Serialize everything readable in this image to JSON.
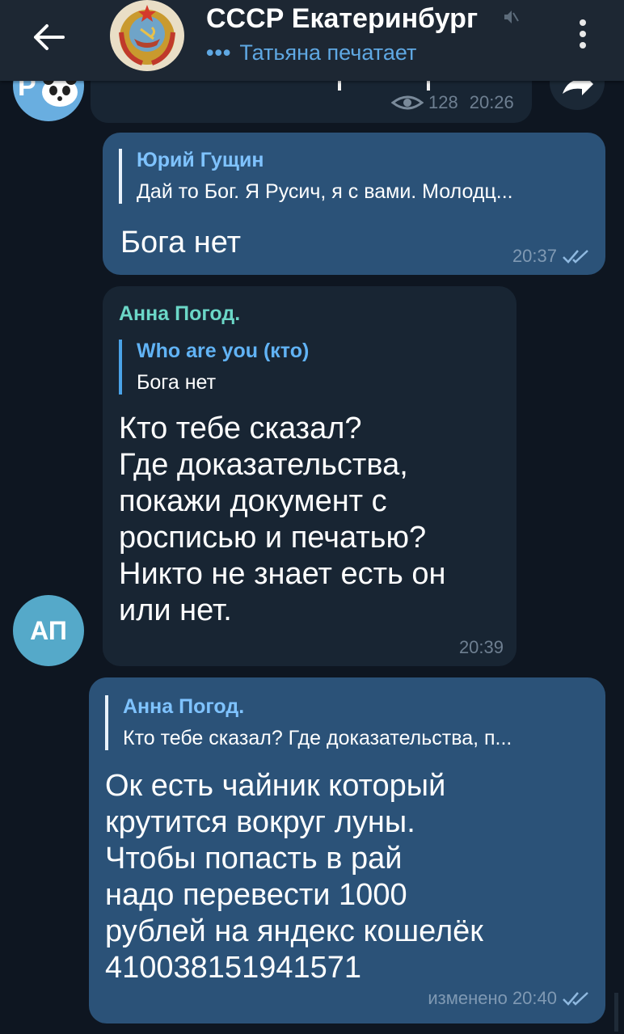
{
  "header": {
    "title": "СССР Екатеринбург",
    "typing_dots": "•••",
    "subtitle": "Татьяна печатает",
    "icons": [
      "back-arrow-icon",
      "mute-icon",
      "more-vert-icon"
    ]
  },
  "messages": [
    {
      "id": "m0",
      "type": "incoming-partial",
      "views": "128",
      "time": "20:26"
    },
    {
      "id": "m1",
      "type": "outgoing",
      "reply_name": "Юрий Гущин",
      "reply_text": "Дай то Бог. Я Русич, я с вами. Молодц...",
      "text": "Бога нет",
      "time": "20:37"
    },
    {
      "id": "m2",
      "type": "incoming",
      "sender": "Анна Погод.",
      "sender_initials": "АП",
      "reply_name": "Who are you (кто)",
      "reply_text": "Бога нет",
      "lines": [
        "Кто тебе сказал?",
        "Где доказательства,",
        "покажи документ с",
        "росписью и печатью?",
        "Никто не знает есть он",
        "или нет."
      ],
      "time": "20:39"
    },
    {
      "id": "m3",
      "type": "outgoing",
      "reply_name": "Анна Погод.",
      "reply_text": "Кто тебе сказал? Где доказательства, п...",
      "lines": [
        "Ок есть чайник который",
        "крутится вокруг луны.",
        "Чтобы попасть в рай",
        "надо перевести 1000",
        "рублей на яндекс кошелёк",
        "410038151941571"
      ],
      "edited_time": "изменено 20:40"
    }
  ],
  "colors": {
    "background": "#0e1621",
    "header": "#1d2733",
    "incoming_bubble": "#182533",
    "outgoing_bubble": "#2b5278",
    "accent": "#5fa8e3",
    "sender_name": "#6bd7c7"
  }
}
